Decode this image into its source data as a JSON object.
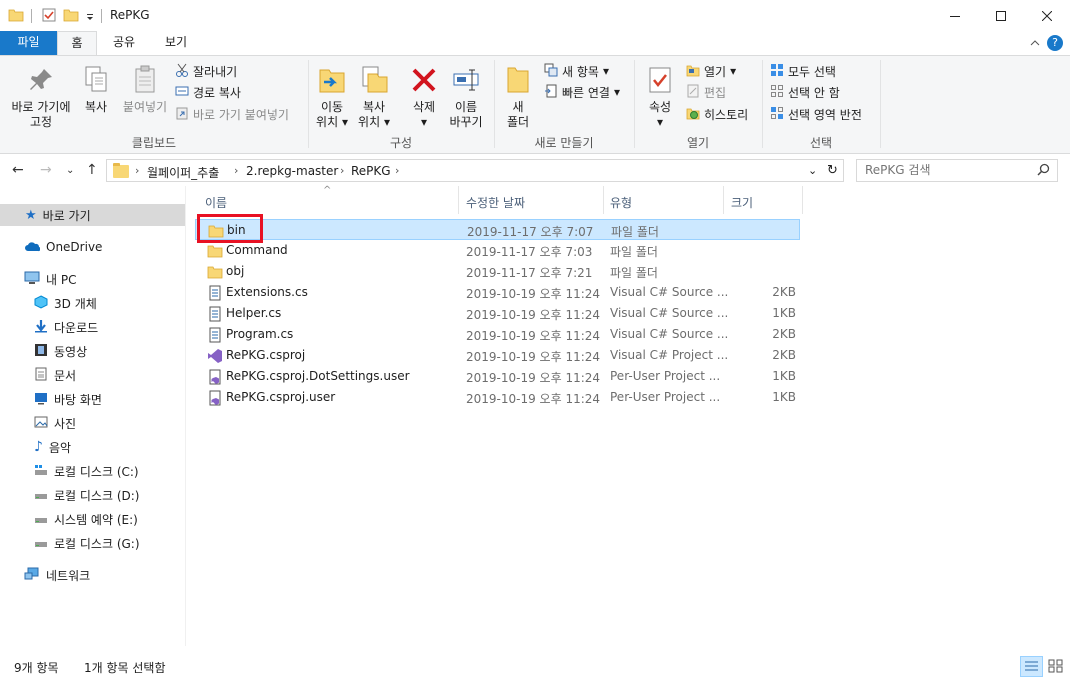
{
  "window": {
    "title": "RePKG",
    "controls": {
      "minimize": "minimize-icon",
      "maximize": "maximize-icon",
      "close": "close-icon"
    }
  },
  "ribbon_tabs": [
    "파일",
    "홈",
    "공유",
    "보기"
  ],
  "ribbon": {
    "clipboard": {
      "pin_label_1": "바로 가기에",
      "pin_label_2": "고정",
      "copy": "복사",
      "paste": "붙여넣기",
      "cut": "잘라내기",
      "copy_path": "경로 복사",
      "paste_shortcut": "바로 가기 붙여넣기",
      "group": "클립보드"
    },
    "organize": {
      "move_1": "이동",
      "move_2": "위치",
      "copyto_1": "복사",
      "copyto_2": "위치",
      "delete": "삭제",
      "rename_1": "이름",
      "rename_2": "바꾸기",
      "group": "구성"
    },
    "new": {
      "folder_1": "새",
      "folder_2": "폴더",
      "new_item": "새 항목",
      "easy_access": "빠른 연결",
      "group": "새로 만들기"
    },
    "open": {
      "properties": "속성",
      "open": "열기",
      "edit": "편집",
      "history": "히스토리",
      "group": "열기"
    },
    "select": {
      "select_all": "모두 선택",
      "select_none": "선택 안 함",
      "invert": "선택 영역 반전",
      "group": "선택"
    }
  },
  "address": {
    "breadcrumbs": [
      "월페이퍼_추출",
      "2.repkg-master",
      "RePKG"
    ],
    "search_placeholder": "RePKG 검색"
  },
  "navpane": {
    "quick_access": "바로 가기",
    "onedrive": "OneDrive",
    "this_pc": "내 PC",
    "items": [
      "3D 개체",
      "다운로드",
      "동영상",
      "문서",
      "바탕 화면",
      "사진",
      "음악",
      "로컬 디스크 (C:)",
      "로컬 디스크 (D:)",
      "시스템 예약 (E:)",
      "로컬 디스크 (G:)"
    ],
    "network": "네트워크"
  },
  "columns": {
    "name": "이름",
    "date": "수정한 날짜",
    "type": "유형",
    "size": "크기"
  },
  "files": [
    {
      "name": "bin",
      "date": "2019-11-17 오후 7:07",
      "type": "파일 폴더",
      "size": "",
      "icon": "folder-icon"
    },
    {
      "name": "Command",
      "date": "2019-11-17 오후 7:03",
      "type": "파일 폴더",
      "size": "",
      "icon": "folder-icon"
    },
    {
      "name": "obj",
      "date": "2019-11-17 오후 7:21",
      "type": "파일 폴더",
      "size": "",
      "icon": "folder-icon"
    },
    {
      "name": "Extensions.cs",
      "date": "2019-10-19 오후 11:24",
      "type": "Visual C# Source ...",
      "size": "2KB",
      "icon": "cs-file-icon"
    },
    {
      "name": "Helper.cs",
      "date": "2019-10-19 오후 11:24",
      "type": "Visual C# Source ...",
      "size": "1KB",
      "icon": "cs-file-icon"
    },
    {
      "name": "Program.cs",
      "date": "2019-10-19 오후 11:24",
      "type": "Visual C# Source ...",
      "size": "2KB",
      "icon": "cs-file-icon"
    },
    {
      "name": "RePKG.csproj",
      "date": "2019-10-19 오후 11:24",
      "type": "Visual C# Project ...",
      "size": "2KB",
      "icon": "vs-project-icon"
    },
    {
      "name": "RePKG.csproj.DotSettings.user",
      "date": "2019-10-19 오후 11:24",
      "type": "Per-User Project ...",
      "size": "1KB",
      "icon": "user-project-icon"
    },
    {
      "name": "RePKG.csproj.user",
      "date": "2019-10-19 오후 11:24",
      "type": "Per-User Project ...",
      "size": "1KB",
      "icon": "user-project-icon"
    }
  ],
  "status": {
    "count": "9개 항목",
    "selected": "1개 항목 선택함"
  },
  "colors": {
    "accent": "#1979ca",
    "selection": "#cce8ff",
    "highlight_box": "#e81123"
  }
}
